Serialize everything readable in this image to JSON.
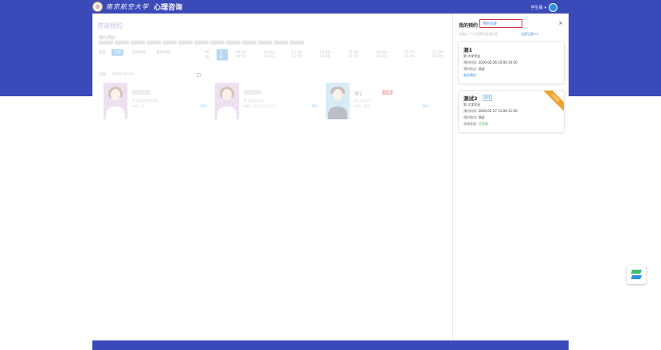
{
  "header": {
    "university_logo_text": "南京航空大学",
    "system_title": "心理咨询",
    "user_name": "学生端"
  },
  "main": {
    "title": "咨询预约",
    "note_label": "预约须知",
    "filters_left": {
      "label": "类型",
      "options": [
        "全部",
        "当前时段",
        "最新时段"
      ]
    },
    "filters_right": {
      "label": "时段",
      "options": [
        "全部",
        "09:00-09:50",
        "10:00-10:50",
        "11:00-11:50",
        "14:00-14:50",
        "15:00-15:50",
        "16:00-16:50",
        "15:35-16:25",
        "21:30-22:20"
      ]
    },
    "date_label": "日期",
    "date_value": "2026-02-26",
    "counselors": [
      {
        "sub": "女 硕士研究生学业",
        "phone": "电话: 11",
        "action": "预约"
      },
      {
        "sub": "女 本科生学业",
        "phone": "电话: 11111111111",
        "action": "预约"
      },
      {
        "name": "测1",
        "tag": "已满",
        "sub": "男 大学学业",
        "phone": "电话: 测试",
        "action": "预约"
      }
    ]
  },
  "side": {
    "title": "我的预约",
    "record_button": "预约记录",
    "tip": "仅展示 7 天内预约咨询信息",
    "tip_link": "全部记录>>",
    "appointments": [
      {
        "name": "测1",
        "lines": [
          {
            "label": "",
            "value": "男 大学学业"
          },
          {
            "label": "预约时间: ",
            "value": "2026-02-26 10:00-10:50"
          },
          {
            "label": "预约地点: ",
            "value": "测试"
          },
          {
            "label": "",
            "value": "取消预约",
            "style": "blue"
          }
        ]
      },
      {
        "name": "测试2",
        "badge": "测试",
        "ribbon": "已完成",
        "lines": [
          {
            "label": "",
            "value": "男 大学学业"
          },
          {
            "label": "预约时间: ",
            "value": "2026-02-27 11:00-11:50"
          },
          {
            "label": "预约地点: ",
            "value": "测试"
          },
          {
            "label": "咨询状态: ",
            "value": "已完成",
            "style": "green"
          }
        ]
      }
    ]
  },
  "colors": {
    "brand_blue": "#3a4ab8",
    "accent_blue": "#2e8fdd",
    "highlight_red": "#d9363e",
    "ribbon_orange": "#f0a128"
  },
  "icons": [
    "close-icon",
    "calendar-icon",
    "chevron-down-icon",
    "chat-widget-icon"
  ]
}
